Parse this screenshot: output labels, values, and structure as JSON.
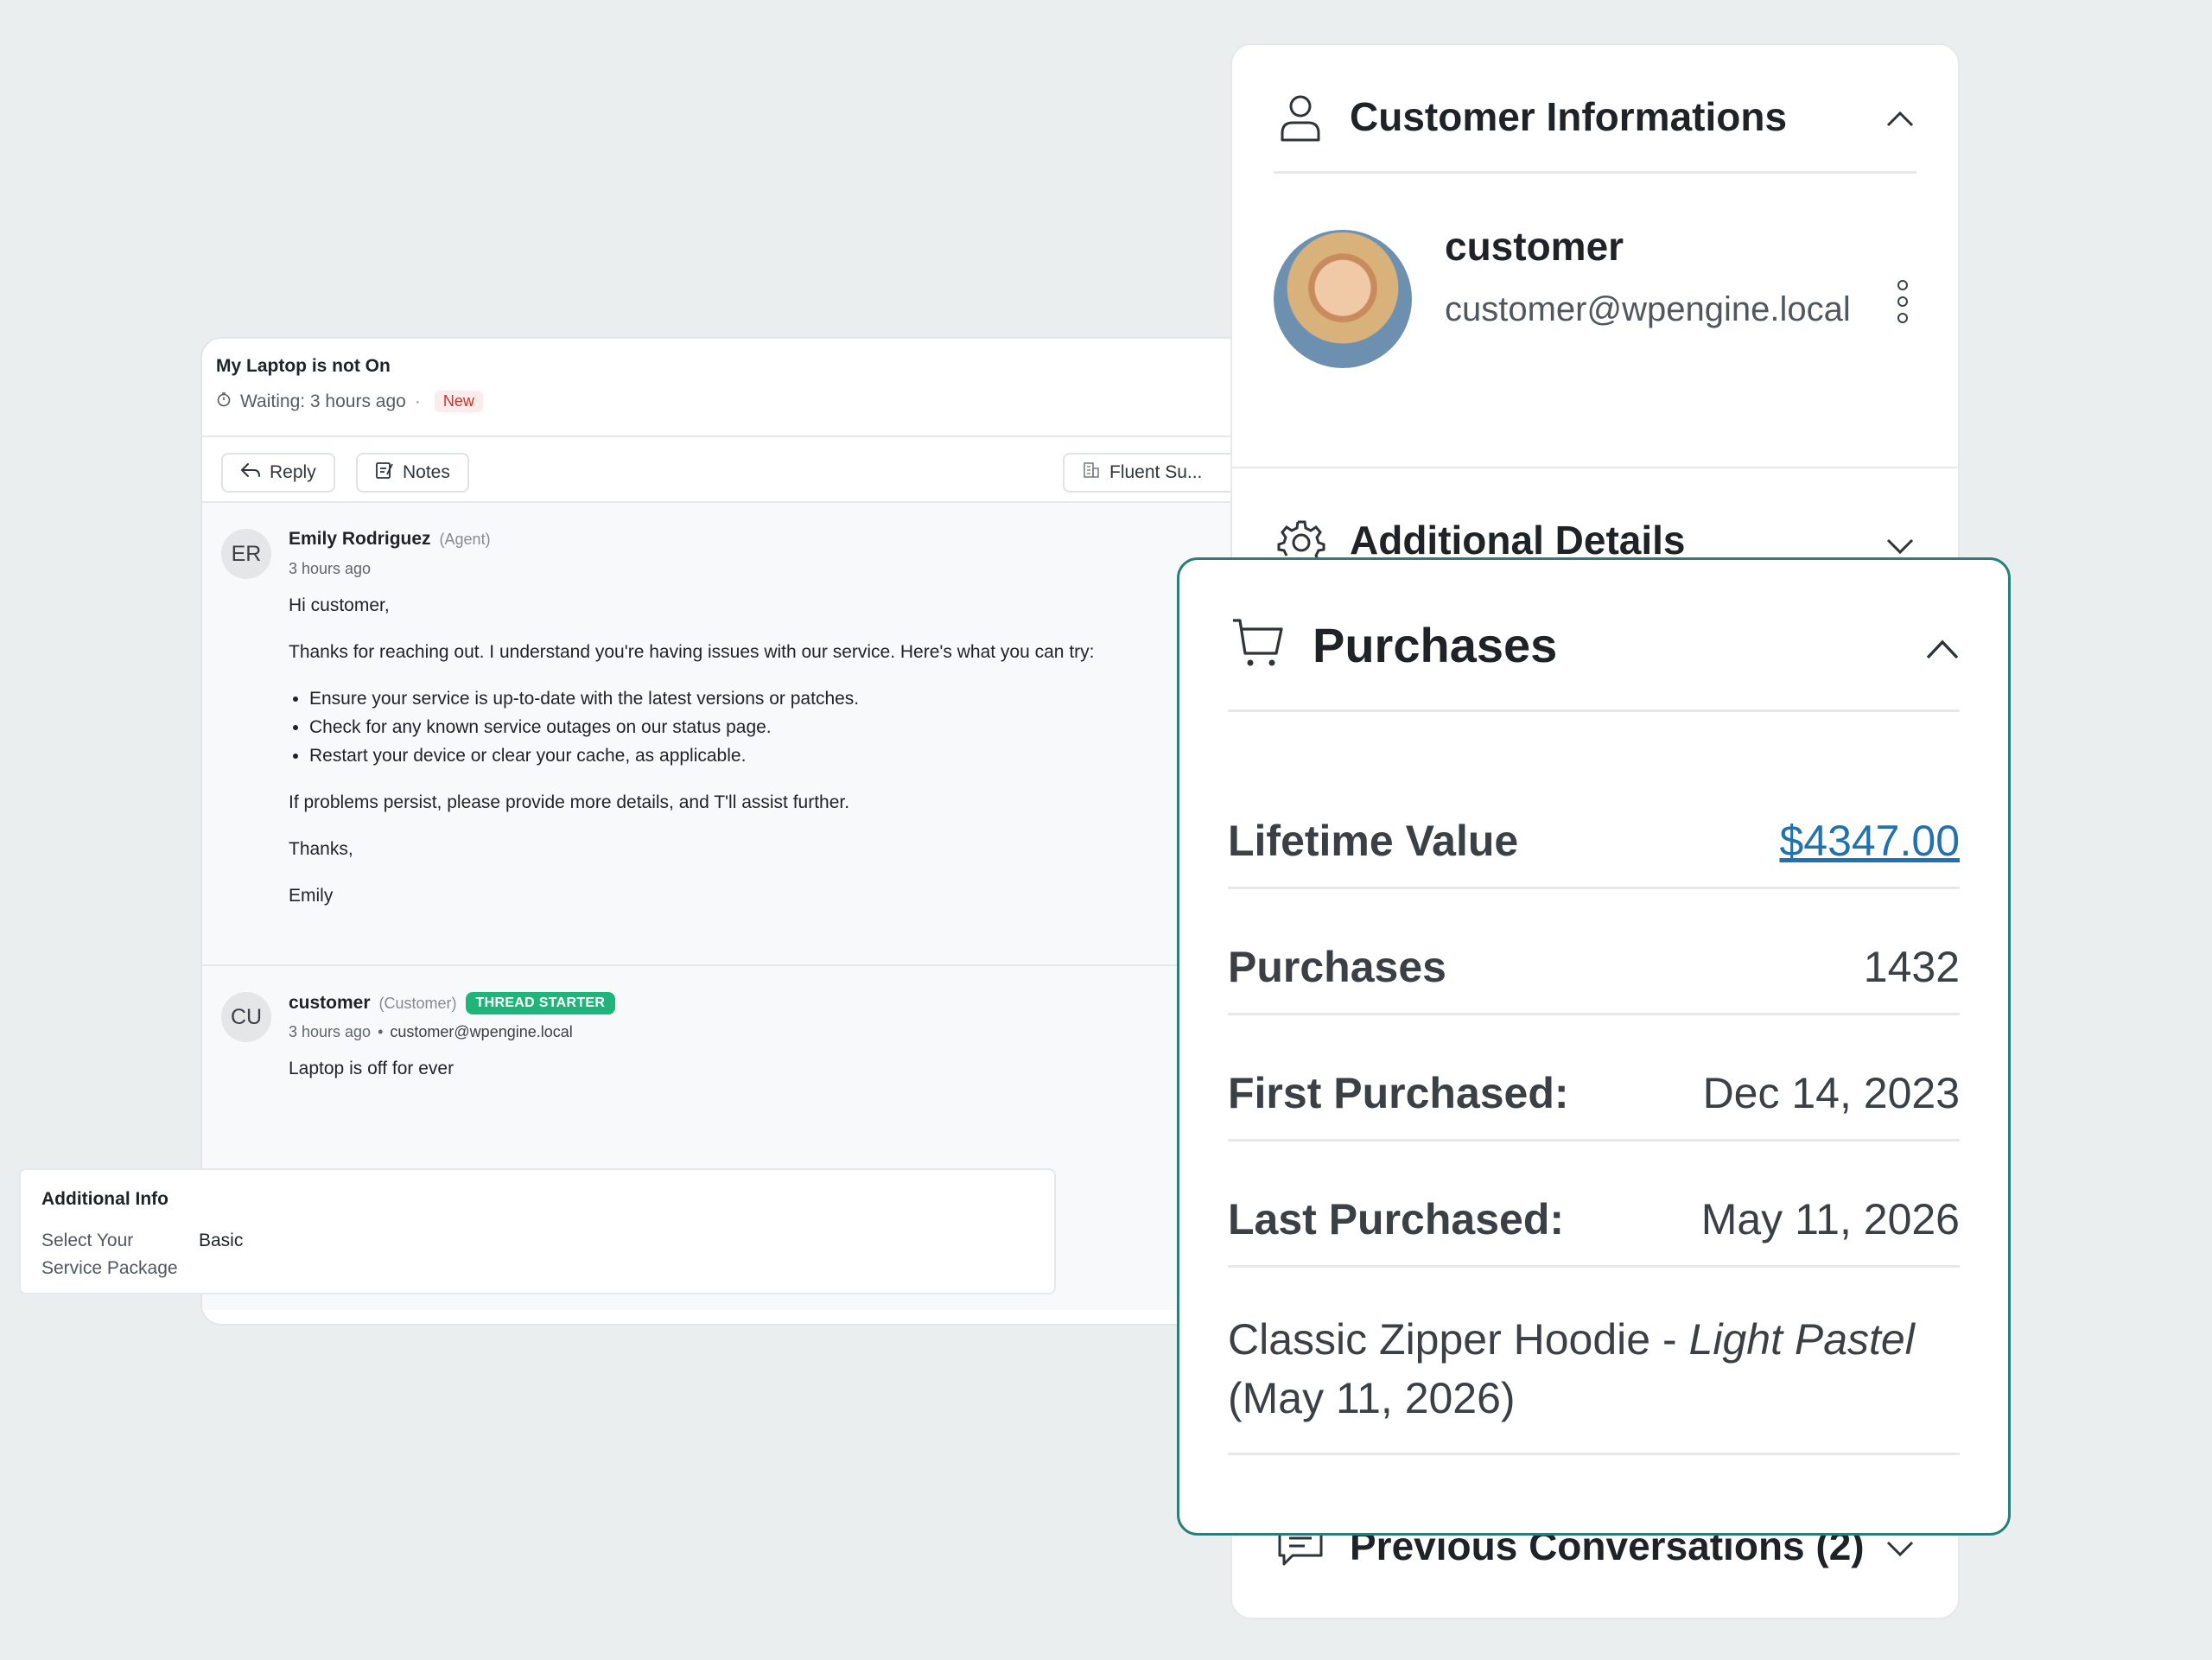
{
  "ticket": {
    "title": "My Laptop is not On",
    "waiting": "Waiting: 3 hours ago",
    "separator": "·",
    "status_badge": "New",
    "toolbar": {
      "reply_label": "Reply",
      "notes_label": "Notes",
      "mailbox_label": "Fluent Su..."
    },
    "messages": [
      {
        "initials": "ER",
        "author": "Emily Rodriguez",
        "role": "(Agent)",
        "time": "3 hours ago",
        "greeting": "Hi customer,",
        "intro": "Thanks for reaching out. I understand you're having issues with our service. Here's what you can try:",
        "bullets": [
          "Ensure your service is up-to-date with the latest versions or patches.",
          "Check for any known service outages on our status page.",
          "Restart your device or clear your cache, as applicable."
        ],
        "closing": "If problems persist, please provide more details, and T'll assist further.",
        "signoff": "Thanks,",
        "signature": "Emily"
      },
      {
        "initials": "CU",
        "author": "customer",
        "role": "(Customer)",
        "badge": "THREAD STARTER",
        "time": "3 hours ago",
        "bullet_sep": "•",
        "email": "customer@wpengine.local",
        "body": "Laptop is off for ever"
      }
    ],
    "additional_info": {
      "title": "Additional Info",
      "field_label": "Select Your Service Package",
      "field_value": "Basic"
    }
  },
  "customer_panel": {
    "section_title": "Customer Informations",
    "name": "customer",
    "email": "customer@wpengine.local",
    "additional_details_title": "Additional Details",
    "previous_conversations_title": "Previous Conversations (2)"
  },
  "purchases": {
    "title": "Purchases",
    "lifetime_label": "Lifetime Value",
    "lifetime_value": "$4347.00",
    "purchases_label": "Purchases",
    "purchases_value": "1432",
    "first_label": "First Purchased:",
    "first_value": "Dec 14, 2023",
    "last_label": "Last Purchased:",
    "last_value": "May 11, 2026",
    "item_name": "Classic Zipper Hoodie - ",
    "item_variant": "Light Pastel",
    "item_date": "(May 11, 2026)"
  },
  "colors": {
    "accent_teal": "#2a7f7b",
    "link_blue": "#2271b1",
    "thread_starter_green": "#1fb57a",
    "new_badge_red": "#d62b2b"
  }
}
